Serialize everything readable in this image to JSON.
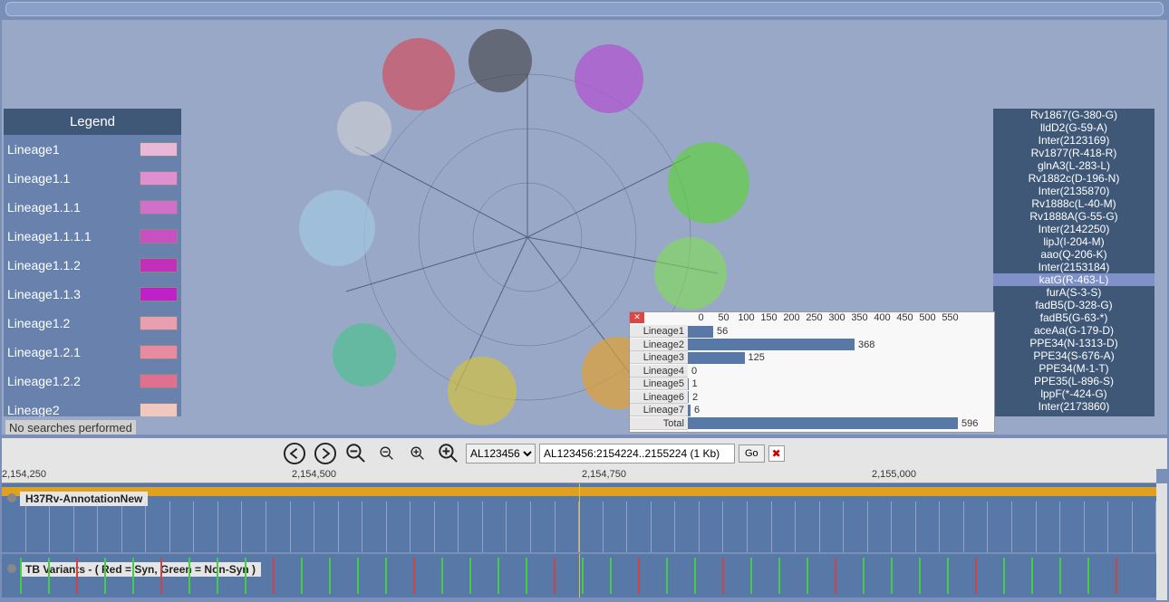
{
  "legend": {
    "title": "Legend",
    "items": [
      {
        "label": "Lineage1",
        "color": "#e8b8d8"
      },
      {
        "label": "Lineage1.1",
        "color": "#e090d0"
      },
      {
        "label": "Lineage1.1.1",
        "color": "#d070c8"
      },
      {
        "label": "Lineage1.1.1.1",
        "color": "#c850c0"
      },
      {
        "label": "Lineage1.1.2",
        "color": "#c030b8"
      },
      {
        "label": "Lineage1.1.3",
        "color": "#c020c8"
      },
      {
        "label": "Lineage1.2",
        "color": "#e8a0b0"
      },
      {
        "label": "Lineage1.2.1",
        "color": "#e88aa0"
      },
      {
        "label": "Lineage1.2.2",
        "color": "#e07090"
      },
      {
        "label": "Lineage2",
        "color": "#f0c8c0"
      }
    ]
  },
  "status": "No searches performed",
  "genes": [
    "Rv1867(G-380-G)",
    "lldD2(G-59-A)",
    "Inter(2123169)",
    "Rv1877(R-418-R)",
    "glnA3(L-283-L)",
    "Rv1882c(D-196-N)",
    "Inter(2135870)",
    "Rv1888c(L-40-M)",
    "Rv1888A(G-55-G)",
    "Inter(2142250)",
    "lipJ(I-204-M)",
    "aao(Q-206-K)",
    "Inter(2153184)",
    "katG(R-463-L)",
    "furA(S-3-S)",
    "fadB5(D-328-G)",
    "fadB5(G-63-*)",
    "aceAa(G-179-D)",
    "PPE34(N-1313-D)",
    "PPE34(S-676-A)",
    "PPE34(M-1-T)",
    "PPE35(L-896-S)",
    "lppF(*-424-G)",
    "Inter(2173860)"
  ],
  "genes_selected": 13,
  "chart_data": {
    "type": "bar",
    "axis": [
      "0",
      "50",
      "100",
      "150",
      "200",
      "250",
      "300",
      "350",
      "400",
      "450",
      "500",
      "550"
    ],
    "categories": [
      "Lineage1",
      "Lineage2",
      "Lineage3",
      "Lineage4",
      "Lineage5",
      "Lineage6",
      "Lineage7",
      "Total"
    ],
    "values": [
      56,
      368,
      125,
      0,
      1,
      2,
      6,
      596
    ],
    "max": 600
  },
  "toolbar": {
    "chromosome": "AL123456",
    "location": "AL123456:2154224..2155224 (1 Kb)",
    "go": "Go"
  },
  "ruler": {
    "ticks": [
      {
        "pos": 0,
        "label": "2,154,250"
      },
      {
        "pos": 320,
        "label": "2,154,500"
      },
      {
        "pos": 640,
        "label": "2,154,750"
      },
      {
        "pos": 960,
        "label": "2,155,000"
      }
    ]
  },
  "tracks": {
    "t1": "H37Rv-AnnotationNew",
    "t2": "TB Variants - ( Red = Syn, Green = Non-Syn )"
  }
}
